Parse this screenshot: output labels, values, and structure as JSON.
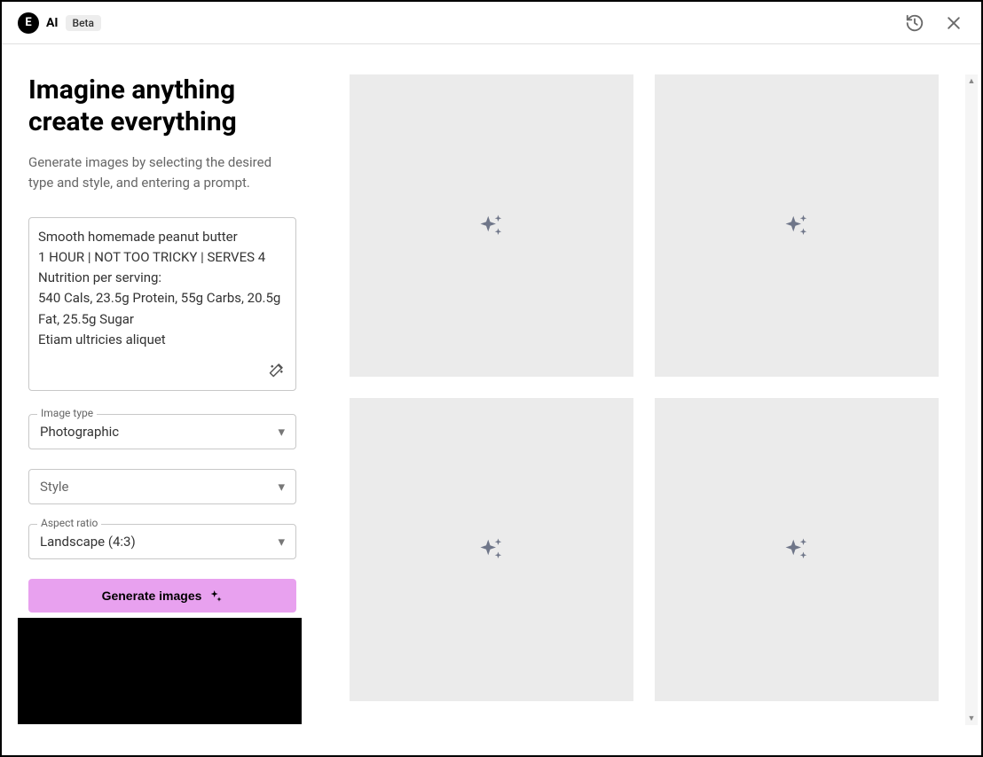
{
  "header": {
    "logo_text": "E",
    "ai_label": "AI",
    "beta_label": "Beta"
  },
  "sidebar": {
    "title": "Imagine anything create everything",
    "subtitle": "Generate images by selecting the desired type and style, and entering a prompt.",
    "prompt_value": "Smooth homemade peanut butter\n1 HOUR | NOT TOO TRICKY | SERVES 4\nNutrition per serving:\n540 Cals, 23.5g Protein, 55g Carbs, 20.5g Fat, 25.5g Sugar\nEtiam ultricies aliquet",
    "image_type": {
      "label": "Image type",
      "value": "Photographic"
    },
    "style": {
      "label": "",
      "value": "Style"
    },
    "aspect_ratio": {
      "label": "Aspect ratio",
      "value": "Landscape (4:3)"
    },
    "generate_label": "Generate images"
  }
}
